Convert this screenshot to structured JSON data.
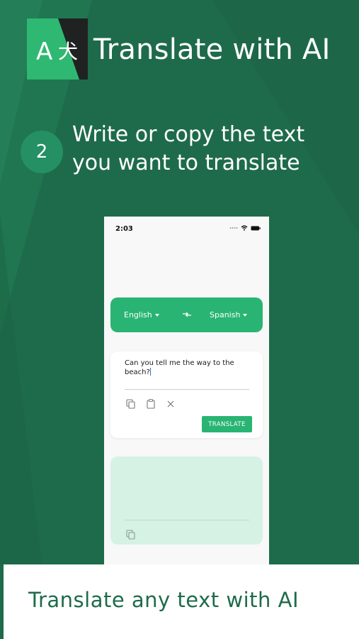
{
  "colors": {
    "background": "#1e6b4b",
    "accent_green": "#29b474",
    "step_circle": "#249063",
    "output_card": "#d6f2e4",
    "banner_text": "#1e6b4b"
  },
  "header": {
    "logo_letter": "A",
    "logo_glyph": "犬",
    "title": "Translate with AI"
  },
  "step": {
    "number": "2",
    "text": "Write or copy the text you want to translate"
  },
  "phone": {
    "status_time": "2:03",
    "status_icons": [
      "signal-dots-icon",
      "wifi-icon",
      "battery-icon"
    ],
    "language_bar": {
      "source": "English",
      "target": "Spanish",
      "swap_icon": "swap-arrows-icon"
    },
    "input": {
      "value": "Can you tell me the way to the beach?",
      "tools": [
        "copy-icon",
        "paste-icon",
        "clear-icon"
      ],
      "translate_button": "TRANSLATE"
    },
    "output": {
      "value": "",
      "tools": [
        "copy-icon"
      ]
    }
  },
  "banner": {
    "text": "Translate any text with AI"
  }
}
